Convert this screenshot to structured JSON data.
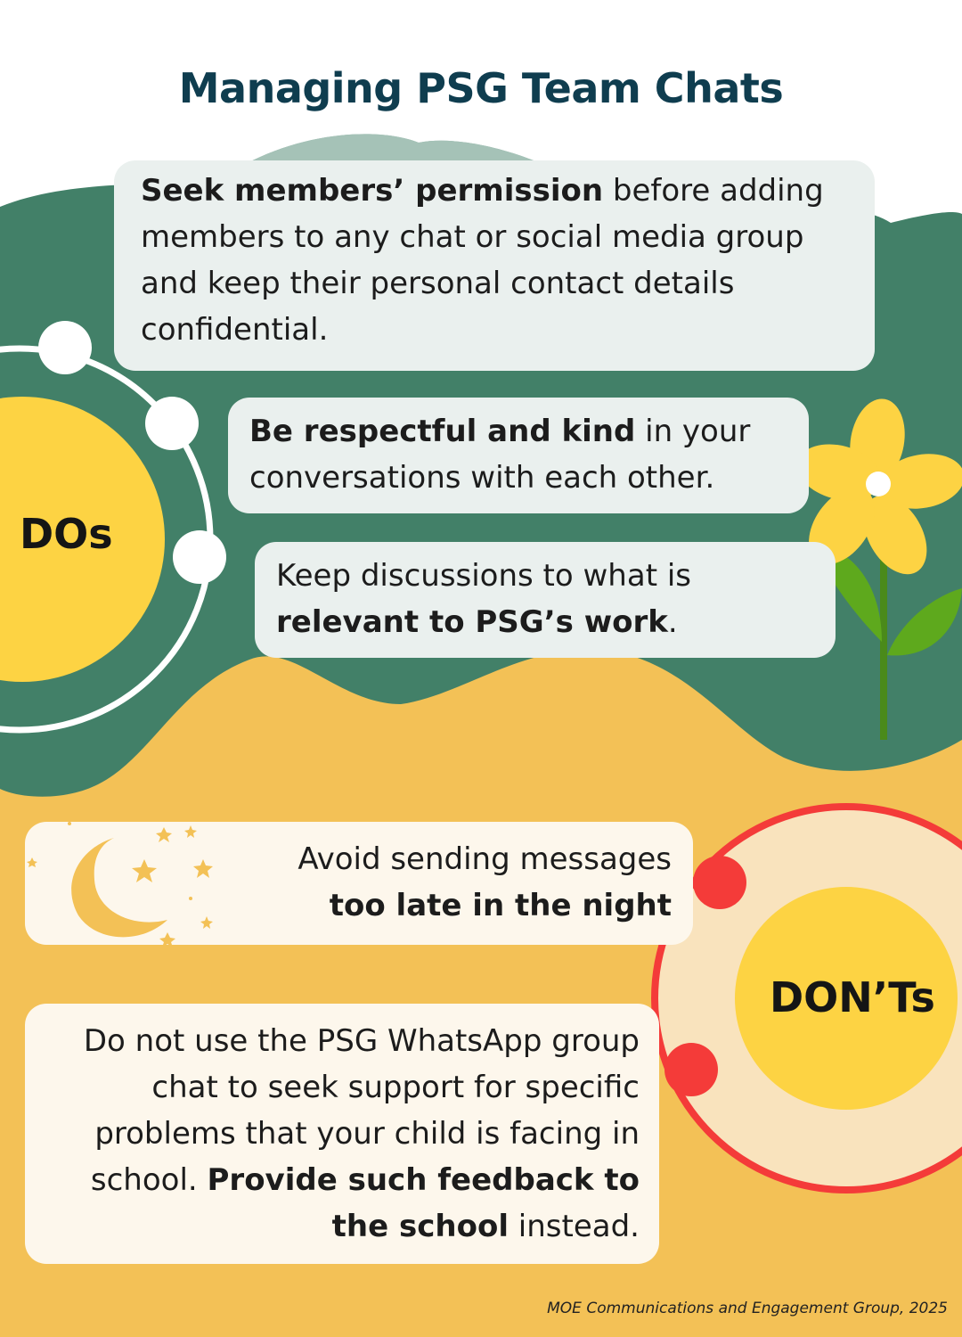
{
  "title": "Managing PSG Team Chats",
  "dos": {
    "label": "DOs",
    "items": [
      {
        "bold": "Seek members’ permission",
        "rest": " before adding members to any chat or social media group and keep their personal contact details confidential."
      },
      {
        "bold": "Be respectful and kind",
        "rest": " in your conversations with each other."
      },
      {
        "pre": "Keep discussions to what is ",
        "bold": "relevant to PSG’s work",
        "rest": "."
      }
    ]
  },
  "donts": {
    "label": "DON’Ts",
    "items": [
      {
        "pre": "Avoid sending messages ",
        "bold": "too late in the night"
      },
      {
        "pre": "Do not use the PSG WhatsApp group chat to seek support for specific problems that your child is facing in school. ",
        "bold": "Provide such feedback to the school",
        "rest": " instead."
      }
    ]
  },
  "credit": "MOE Communications and Engagement Group, 2025",
  "icons": [
    "flower-icon",
    "moon-icon",
    "star-icon"
  ],
  "colors": {
    "title": "#0f3d4f",
    "green": "#428068",
    "orange": "#f3c156",
    "yellow": "#fdd343",
    "red": "#f43b39",
    "cream": "#f9e3bd",
    "leaf": "#5ea91d"
  }
}
